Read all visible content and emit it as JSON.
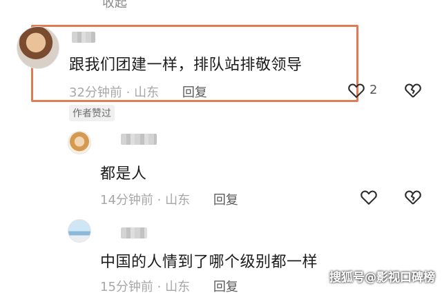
{
  "top_cut_text": "收起",
  "comments": [
    {
      "text": "跟我们团建一样，排队站排敬领导",
      "time": "32分钟前",
      "location": "山东",
      "reply_label": "回复",
      "likes": "2",
      "badge": "作者赞过",
      "highlighted": true
    },
    {
      "text": "都是人",
      "time": "14分钟前",
      "location": "山东",
      "reply_label": "回复"
    },
    {
      "text": "中国的人情到了哪个级别都一样",
      "time": "15分钟前",
      "location": "山东",
      "reply_label": "回复"
    }
  ],
  "meta_separator": " · ",
  "icons": {
    "like": "heart-outline-icon",
    "dislike": "broken-heart-icon"
  },
  "watermark": "搜狐号@影视口碑榜",
  "colors": {
    "highlight_border": "#e07a52",
    "meta_text": "#a7a7a7",
    "main_text": "#1b1b1b"
  }
}
